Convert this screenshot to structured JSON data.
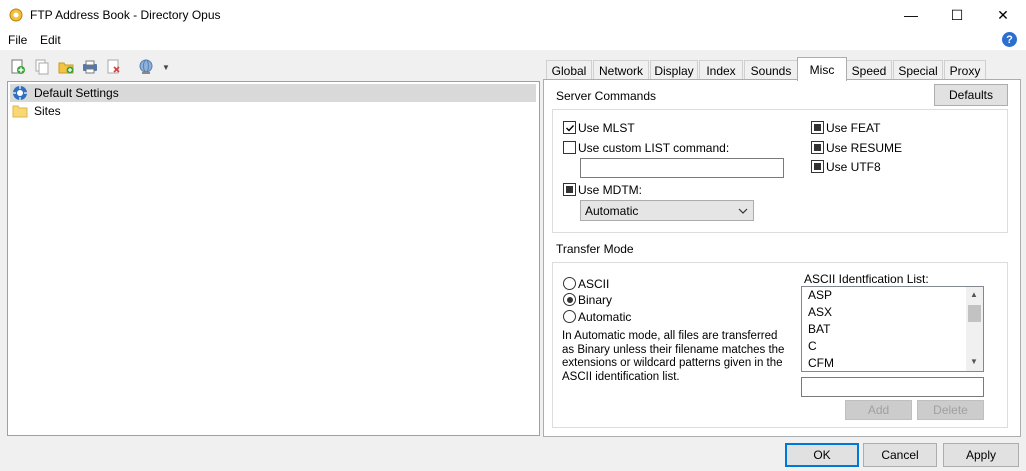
{
  "window": {
    "title": "FTP Address Book - Directory Opus",
    "minimize": "—",
    "maximize": "☐",
    "close": "✕"
  },
  "menu": [
    "File",
    "Edit"
  ],
  "help": "?",
  "tree": {
    "items": [
      {
        "label": "Default Settings"
      },
      {
        "label": "Sites"
      }
    ]
  },
  "tabs": [
    "Global",
    "Network",
    "Display",
    "Index",
    "Sounds",
    "Misc",
    "Speed",
    "Special",
    "Proxy"
  ],
  "misc": {
    "server_commands_label": "Server Commands",
    "defaults_button": "Defaults",
    "use_mlst": "Use MLST",
    "use_custom_list": "Use custom LIST command:",
    "custom_list_value": "",
    "use_mdtm": "Use MDTM:",
    "mdtm_select": "Automatic",
    "use_feat": "Use FEAT",
    "use_resume": "Use RESUME",
    "use_utf8": "Use UTF8",
    "transfer_mode_label": "Transfer Mode",
    "mode_ascii": "ASCII",
    "mode_binary": "Binary",
    "mode_automatic": "Automatic",
    "description": "In Automatic mode, all files are transferred as Binary unless their filename matches the extensions or wildcard patterns given in the ASCII identification list.",
    "ascii_list_label": "ASCII Identfication List:",
    "ascii_list": [
      "ASP",
      "ASX",
      "BAT",
      "C",
      "CFM"
    ],
    "ascii_input_value": "",
    "add_button": "Add",
    "delete_button": "Delete"
  },
  "footer": {
    "ok": "OK",
    "cancel": "Cancel",
    "apply": "Apply"
  }
}
